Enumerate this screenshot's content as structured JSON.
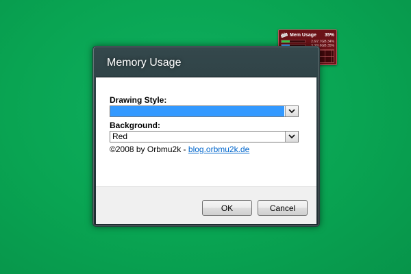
{
  "gadget": {
    "title": "Mem Usage",
    "percent": "35%",
    "icon": "memory-chip-icon",
    "rows": [
      {
        "text": "2.6/7.7GB 34%",
        "fill_fraction": 0.34,
        "color": "#36d04a"
      },
      {
        "text": "3.3/9.6GB 35%",
        "fill_fraction": 0.35,
        "color": "#3aa3ff"
      }
    ],
    "colors": {
      "background": "#6a1217",
      "border": "#b65a5e"
    }
  },
  "dialog": {
    "title": "Memory Usage",
    "drawing_style": {
      "label": "Drawing Style:",
      "value": "",
      "highlight_color": "#3399ff"
    },
    "background": {
      "label": "Background:",
      "value": "Red"
    },
    "dropdown_icon": "chevron-down-icon",
    "copyright_text": "©2008 by Orbmu2k - ",
    "link_text": "blog.orbmu2k.de",
    "link_color": "#0066cc",
    "ok_label": "OK",
    "cancel_label": "Cancel"
  },
  "desktop": {
    "background_color": "#09a452"
  }
}
